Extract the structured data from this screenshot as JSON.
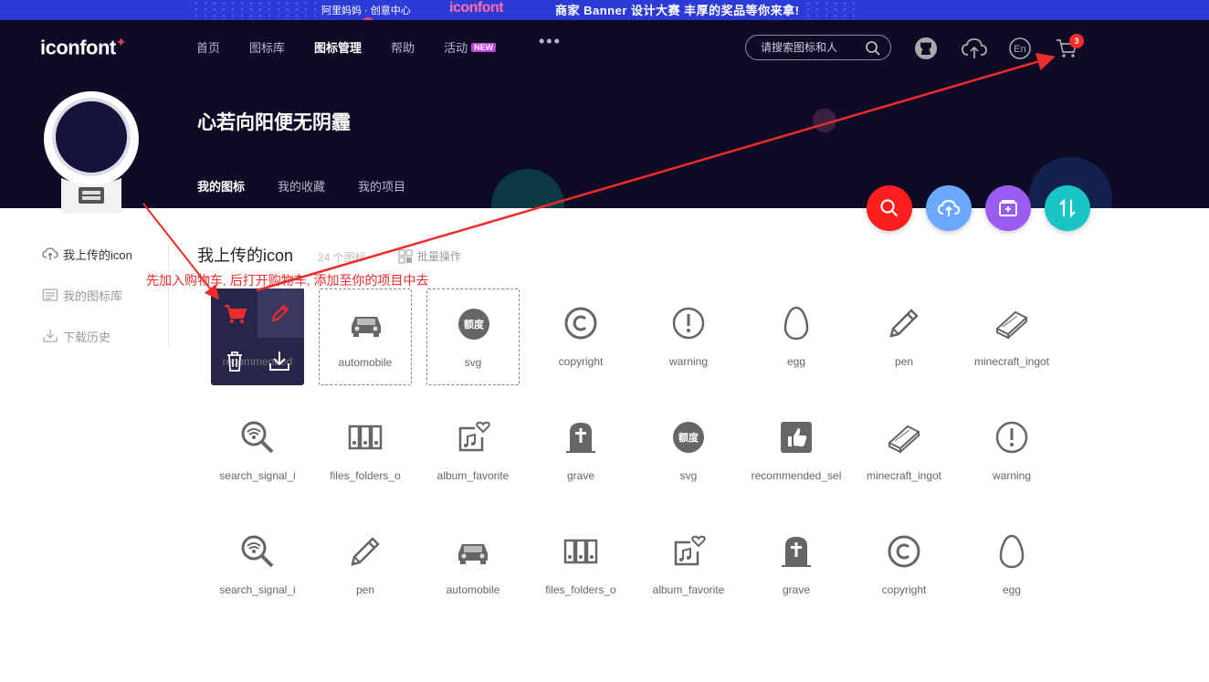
{
  "promo": {
    "brand1": "阿里妈妈 · 创意中心",
    "brand2": "iconfont",
    "slogan": "商家 Banner 设计大赛    丰厚的奖品等你来拿!"
  },
  "header": {
    "logo": "iconfont",
    "nav": [
      "首页",
      "图标库",
      "图标管理",
      "帮助",
      "活动"
    ],
    "nav_active": "图标管理",
    "new_badge": "NEW",
    "more": "•••",
    "search_placeholder": "请搜索图标和人",
    "cart_count": "3"
  },
  "profile": {
    "username": "心若向阳便无阴霾",
    "tabs": [
      "我的图标",
      "我的收藏",
      "我的项目"
    ]
  },
  "sidebar": {
    "items": [
      "我上传的icon",
      "我的图标库",
      "下载历史"
    ]
  },
  "main": {
    "title": "我上传的icon",
    "count": "24 个图标",
    "batch": "批量操作",
    "hint": "先加入购物车, 后打开购物车, 添加至你的项目中去"
  },
  "icons": [
    {
      "name": "recommended"
    },
    {
      "name": "automobile"
    },
    {
      "name": "svg"
    },
    {
      "name": "copyright"
    },
    {
      "name": "warning"
    },
    {
      "name": "egg"
    },
    {
      "name": "pen"
    },
    {
      "name": "minecraft_ingot"
    },
    {
      "name": "search_signal_i"
    },
    {
      "name": "files_folders_o"
    },
    {
      "name": "album_favorite"
    },
    {
      "name": "grave"
    },
    {
      "name": "svg"
    },
    {
      "name": "recommended_sel"
    },
    {
      "name": "minecraft_ingot"
    },
    {
      "name": "warning"
    },
    {
      "name": "search_signal_i"
    },
    {
      "name": "pen"
    },
    {
      "name": "automobile"
    },
    {
      "name": "files_folders_o"
    },
    {
      "name": "album_favorite"
    },
    {
      "name": "grave"
    },
    {
      "name": "copyright"
    },
    {
      "name": "egg"
    }
  ],
  "svg_badge_text": "额度",
  "colors": {
    "header_bg": "#0e0b26",
    "promo_bg": "#2d3bd6",
    "fab_search": "#ff1e1e",
    "fab_upload": "#6aa9ff",
    "fab_project": "#9a5cf0",
    "fab_sort": "#19c4c4",
    "annotation": "#f02b2b"
  }
}
